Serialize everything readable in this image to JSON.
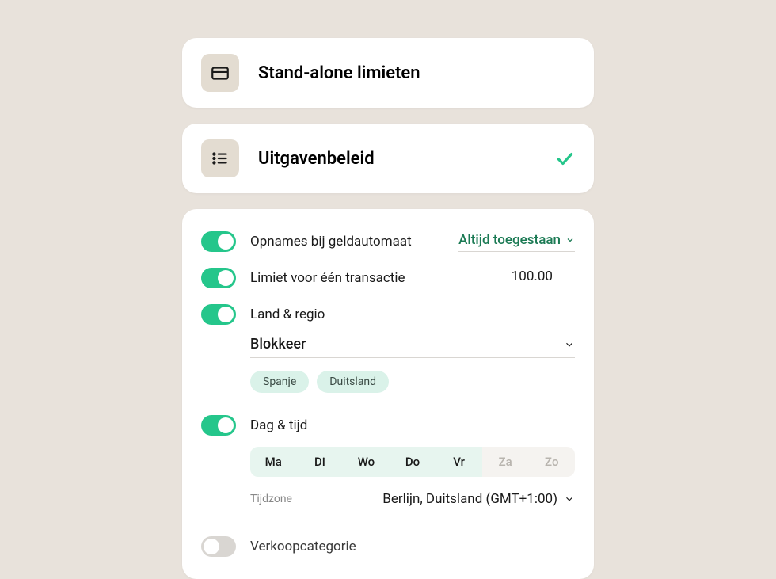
{
  "card1": {
    "title": "Stand-alone limieten"
  },
  "card2": {
    "title": "Uitgavenbeleid"
  },
  "settings": {
    "atm": {
      "label": "Opnames bij geldautomaat",
      "value": "Altijd toegestaan"
    },
    "single_tx": {
      "label": "Limiet voor één transactie",
      "value": "100.00"
    },
    "region": {
      "label": "Land & regio",
      "mode": "Blokkeer",
      "chips": [
        "Spanje",
        "Duitsland"
      ]
    },
    "daytime": {
      "label": "Dag & tijd",
      "days": [
        {
          "abbr": "Ma",
          "active": true
        },
        {
          "abbr": "Di",
          "active": true
        },
        {
          "abbr": "Wo",
          "active": true
        },
        {
          "abbr": "Do",
          "active": true
        },
        {
          "abbr": "Vr",
          "active": true
        },
        {
          "abbr": "Za",
          "active": false
        },
        {
          "abbr": "Zo",
          "active": false
        }
      ],
      "tz_label": "Tijdzone",
      "tz_value": "Berlijn, Duitsland (GMT+1:00)"
    },
    "category": {
      "label": "Verkoopcategorie"
    }
  }
}
